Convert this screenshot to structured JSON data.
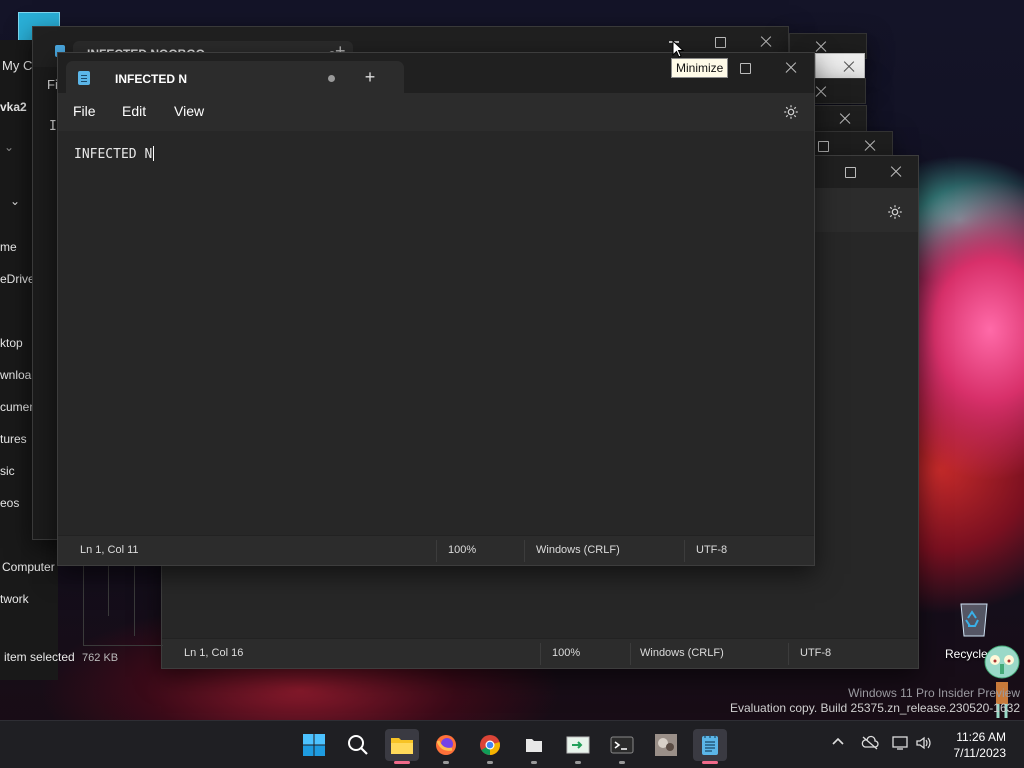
{
  "colors": {
    "accent": "#f06a8a",
    "notepad_bg": "#272727",
    "titlebar": "#202020"
  },
  "explorer": {
    "tab_title": "INFECTED NOOBGO",
    "sidebar": {
      "title_partial": "My C",
      "user_partial": "vka2",
      "menu_partial": "Fil",
      "text_partial": "I",
      "items": [
        "me",
        "eDrive",
        "ktop",
        "wnloa",
        "cumen",
        "tures",
        "sic",
        "eos",
        "Computer",
        "twork"
      ]
    },
    "status": {
      "selected": "item selected",
      "size": "762 KB"
    }
  },
  "notepad": {
    "tab_title": "INFECTED N",
    "newtab_label": "+",
    "menu": {
      "file": "File",
      "edit": "Edit",
      "view": "View"
    },
    "content": "INFECTED N",
    "status": {
      "position": "Ln 1, Col 11",
      "zoom": "100%",
      "line_ending": "Windows (CRLF)",
      "encoding": "UTF-8"
    }
  },
  "notepad_back": {
    "status": {
      "position": "Ln 1, Col 16",
      "zoom": "100%",
      "line_ending": "Windows (CRLF)",
      "encoding": "UTF-8"
    }
  },
  "tooltip": "Minimize",
  "desktop": {
    "recycle_label": "Recycle",
    "watermark_line1": "Windows 11 Pro Insider Preview",
    "watermark_line2": "Evaluation copy. Build 25375.zn_release.230520-1632"
  },
  "taskbar": {
    "apps": [
      "start-icon",
      "search-icon",
      "file-explorer-icon",
      "firefox-icon",
      "chrome-icon",
      "files-icon",
      "terminal-preview-icon",
      "terminal-icon",
      "photo-icon",
      "notepad-icon"
    ],
    "time": "11:26 AM",
    "date": "7/11/2023"
  }
}
